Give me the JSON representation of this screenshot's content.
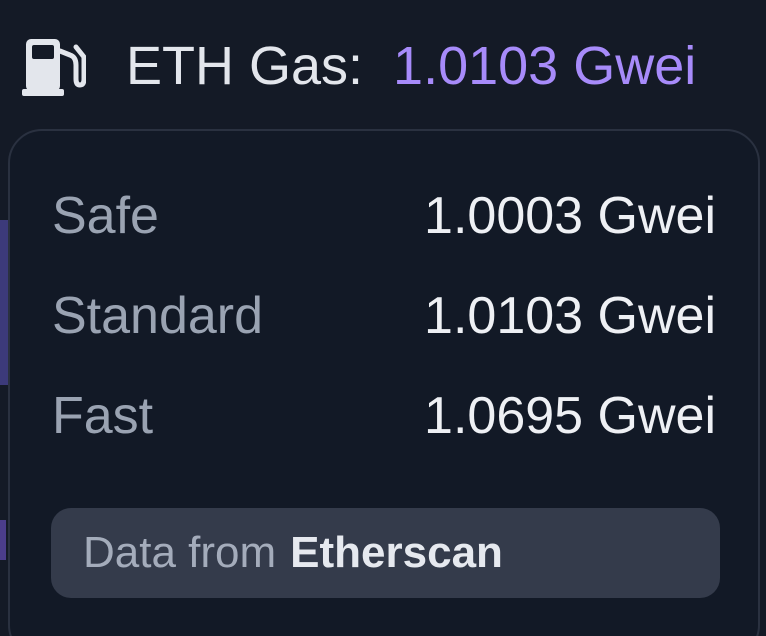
{
  "header": {
    "icon": "gas-pump-icon",
    "label": "ETH Gas:",
    "value": "1.0103 Gwei"
  },
  "popover": {
    "rows": [
      {
        "label": "Safe",
        "value": "1.0003 Gwei"
      },
      {
        "label": "Standard",
        "value": "1.0103 Gwei"
      },
      {
        "label": "Fast",
        "value": "1.0695 Gwei"
      }
    ],
    "source": {
      "prefix": "Data from",
      "name": "Etherscan"
    }
  },
  "colors": {
    "background": "#141a26",
    "accent": "#a78bfa",
    "popover_border": "#2a3140",
    "source_box": "#343b4b"
  }
}
